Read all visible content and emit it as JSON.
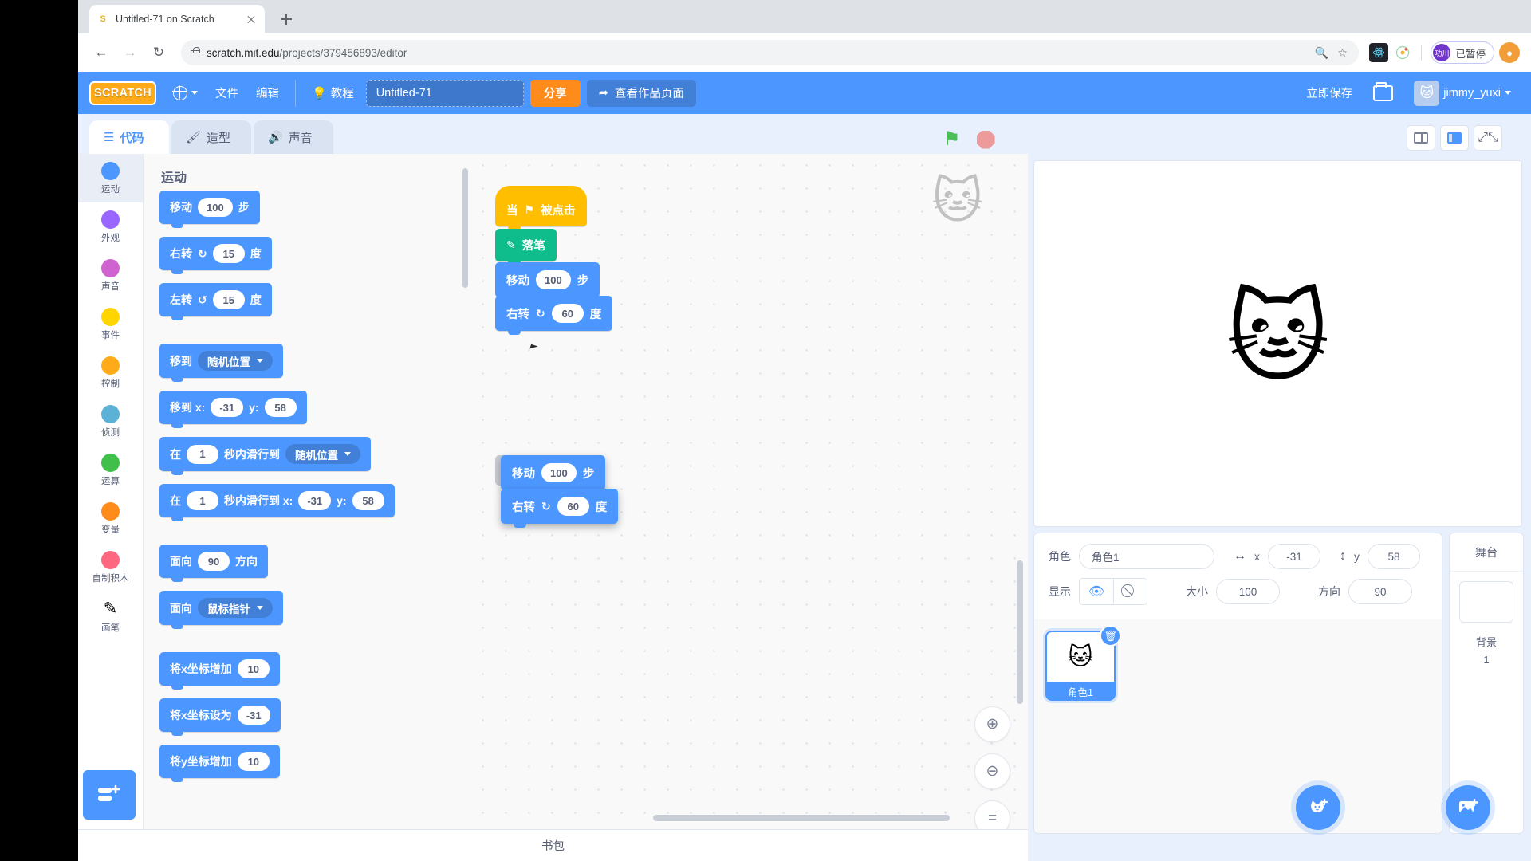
{
  "browser": {
    "tab": {
      "title": "Untitled-71 on Scratch",
      "favicon": "scratch-favicon"
    },
    "newtab_label": "+",
    "nav": {
      "back": "←",
      "forward": "→",
      "reload": "↻"
    },
    "url_domain": "scratch.mit.edu",
    "url_path": "/projects/379456893/editor",
    "omni_icons": [
      "zoom-icon",
      "bookmark-star-icon"
    ],
    "extensions": [
      "react-devtools-icon",
      "orbit-extension-icon"
    ],
    "pause_badge": {
      "avatar": "功川",
      "label": "已暂停"
    },
    "profile_initial": "●"
  },
  "menubar": {
    "logo": "SCRATCH",
    "language": "globe-icon",
    "file": "文件",
    "edit": "编辑",
    "tutorials": "教程",
    "project_title": "Untitled-71",
    "share": "分享",
    "see_project_page": "查看作品页面",
    "save_now": "立即保存",
    "folder_icon": "folder-icon",
    "username": "jimmy_yuxi"
  },
  "tabs": [
    {
      "label": "代码",
      "icon": "code-icon",
      "active": true
    },
    {
      "label": "造型",
      "icon": "brush-icon",
      "active": false
    },
    {
      "label": "声音",
      "icon": "speaker-icon",
      "active": false
    }
  ],
  "stage_controls": {
    "go": "green-flag-icon",
    "stop": "stop-icon"
  },
  "layout_controls": [
    "small-stage-icon",
    "large-stage-icon",
    "fullscreen-icon"
  ],
  "categories": [
    {
      "label": "运动",
      "color": "#4c97ff",
      "selected": true
    },
    {
      "label": "外观",
      "color": "#9966ff",
      "selected": false
    },
    {
      "label": "声音",
      "color": "#cf63cf",
      "selected": false
    },
    {
      "label": "事件",
      "color": "#ffd500",
      "selected": false
    },
    {
      "label": "控制",
      "color": "#ffab19",
      "selected": false
    },
    {
      "label": "侦测",
      "color": "#5cb1d6",
      "selected": false
    },
    {
      "label": "运算",
      "color": "#40bf4a",
      "selected": false
    },
    {
      "label": "变量",
      "color": "#ff8c1a",
      "selected": false
    },
    {
      "label": "自制积木",
      "color": "#ff6680",
      "selected": false
    },
    {
      "label": "画笔",
      "color": "#0fbd8c",
      "selected": false
    }
  ],
  "add_extension_label": "add-extension-icon",
  "palette": {
    "header": "运动",
    "blocks": [
      {
        "parts": [
          {
            "t": "text",
            "v": "移动"
          },
          {
            "t": "oval",
            "v": "100"
          },
          {
            "t": "text",
            "v": "步"
          }
        ]
      },
      {
        "parts": [
          {
            "t": "text",
            "v": "右转"
          },
          {
            "t": "icon",
            "v": "↻"
          },
          {
            "t": "oval",
            "v": "15"
          },
          {
            "t": "text",
            "v": "度"
          }
        ]
      },
      {
        "parts": [
          {
            "t": "text",
            "v": "左转"
          },
          {
            "t": "icon",
            "v": "↺"
          },
          {
            "t": "oval",
            "v": "15"
          },
          {
            "t": "text",
            "v": "度"
          }
        ],
        "gap": true
      },
      {
        "parts": [
          {
            "t": "text",
            "v": "移到"
          },
          {
            "t": "drop",
            "v": "随机位置"
          }
        ]
      },
      {
        "parts": [
          {
            "t": "text",
            "v": "移到 x:"
          },
          {
            "t": "oval",
            "v": "-31"
          },
          {
            "t": "text",
            "v": "y:"
          },
          {
            "t": "oval",
            "v": "58"
          }
        ]
      },
      {
        "parts": [
          {
            "t": "text",
            "v": "在"
          },
          {
            "t": "oval",
            "v": "1"
          },
          {
            "t": "text",
            "v": "秒内滑行到"
          },
          {
            "t": "drop",
            "v": "随机位置"
          }
        ]
      },
      {
        "parts": [
          {
            "t": "text",
            "v": "在"
          },
          {
            "t": "oval",
            "v": "1"
          },
          {
            "t": "text",
            "v": "秒内滑行到 x:"
          },
          {
            "t": "oval",
            "v": "-31"
          },
          {
            "t": "text",
            "v": "y:"
          },
          {
            "t": "oval",
            "v": "58"
          }
        ],
        "gap": true
      },
      {
        "parts": [
          {
            "t": "text",
            "v": "面向"
          },
          {
            "t": "oval",
            "v": "90"
          },
          {
            "t": "text",
            "v": "方向"
          }
        ]
      },
      {
        "parts": [
          {
            "t": "text",
            "v": "面向"
          },
          {
            "t": "drop",
            "v": "鼠标指针"
          }
        ],
        "gap": true
      },
      {
        "parts": [
          {
            "t": "text",
            "v": "将x坐标增加"
          },
          {
            "t": "oval",
            "v": "10"
          }
        ]
      },
      {
        "parts": [
          {
            "t": "text",
            "v": "将x坐标设为"
          },
          {
            "t": "oval",
            "v": "-31"
          }
        ]
      },
      {
        "parts": [
          {
            "t": "text",
            "v": "将y坐标增加"
          },
          {
            "t": "oval",
            "v": "10"
          }
        ]
      }
    ]
  },
  "script": {
    "attached": [
      {
        "type": "hat",
        "parts": [
          {
            "t": "text",
            "v": "当"
          },
          {
            "t": "icon",
            "v": "⚑"
          },
          {
            "t": "text",
            "v": "被点击"
          }
        ]
      },
      {
        "type": "pen",
        "parts": [
          {
            "t": "icon",
            "v": "✎"
          },
          {
            "t": "text",
            "v": "落笔"
          }
        ]
      },
      {
        "type": "motion",
        "parts": [
          {
            "t": "text",
            "v": "移动"
          },
          {
            "t": "oval",
            "v": "100"
          },
          {
            "t": "text",
            "v": "步"
          }
        ]
      },
      {
        "type": "motion",
        "parts": [
          {
            "t": "text",
            "v": "右转"
          },
          {
            "t": "icon",
            "v": "↻"
          },
          {
            "t": "oval",
            "v": "60"
          },
          {
            "t": "text",
            "v": "度"
          }
        ]
      }
    ],
    "dragging": [
      {
        "type": "motion",
        "parts": [
          {
            "t": "text",
            "v": "移动"
          },
          {
            "t": "oval",
            "v": "100"
          },
          {
            "t": "text",
            "v": "步"
          }
        ]
      },
      {
        "type": "motion",
        "parts": [
          {
            "t": "text",
            "v": "右转"
          },
          {
            "t": "icon",
            "v": "↻"
          },
          {
            "t": "oval",
            "v": "60"
          },
          {
            "t": "text",
            "v": "度"
          }
        ]
      }
    ]
  },
  "canvas_controls": {
    "zoom_in": "zoom-in-icon",
    "zoom_out": "zoom-out-icon",
    "zoom_reset": "zoom-reset-icon"
  },
  "sprite_info": {
    "sprite_label": "角色",
    "sprite_name": "角色1",
    "x_label": "x",
    "x_value": "-31",
    "y_label": "y",
    "y_value": "58",
    "show_label": "显示",
    "size_label": "大小",
    "size_value": "100",
    "direction_label": "方向",
    "direction_value": "90"
  },
  "sprite_list": [
    {
      "name": "角色1",
      "selected": true,
      "thumb": "cat-sprite-icon"
    }
  ],
  "stage_panel": {
    "header": "舞台",
    "backdrop_label": "背景",
    "backdrop_count": "1"
  },
  "fabs": {
    "add_sprite": "add-sprite-icon",
    "add_backdrop": "add-backdrop-icon"
  },
  "backpack": {
    "label": "书包"
  }
}
